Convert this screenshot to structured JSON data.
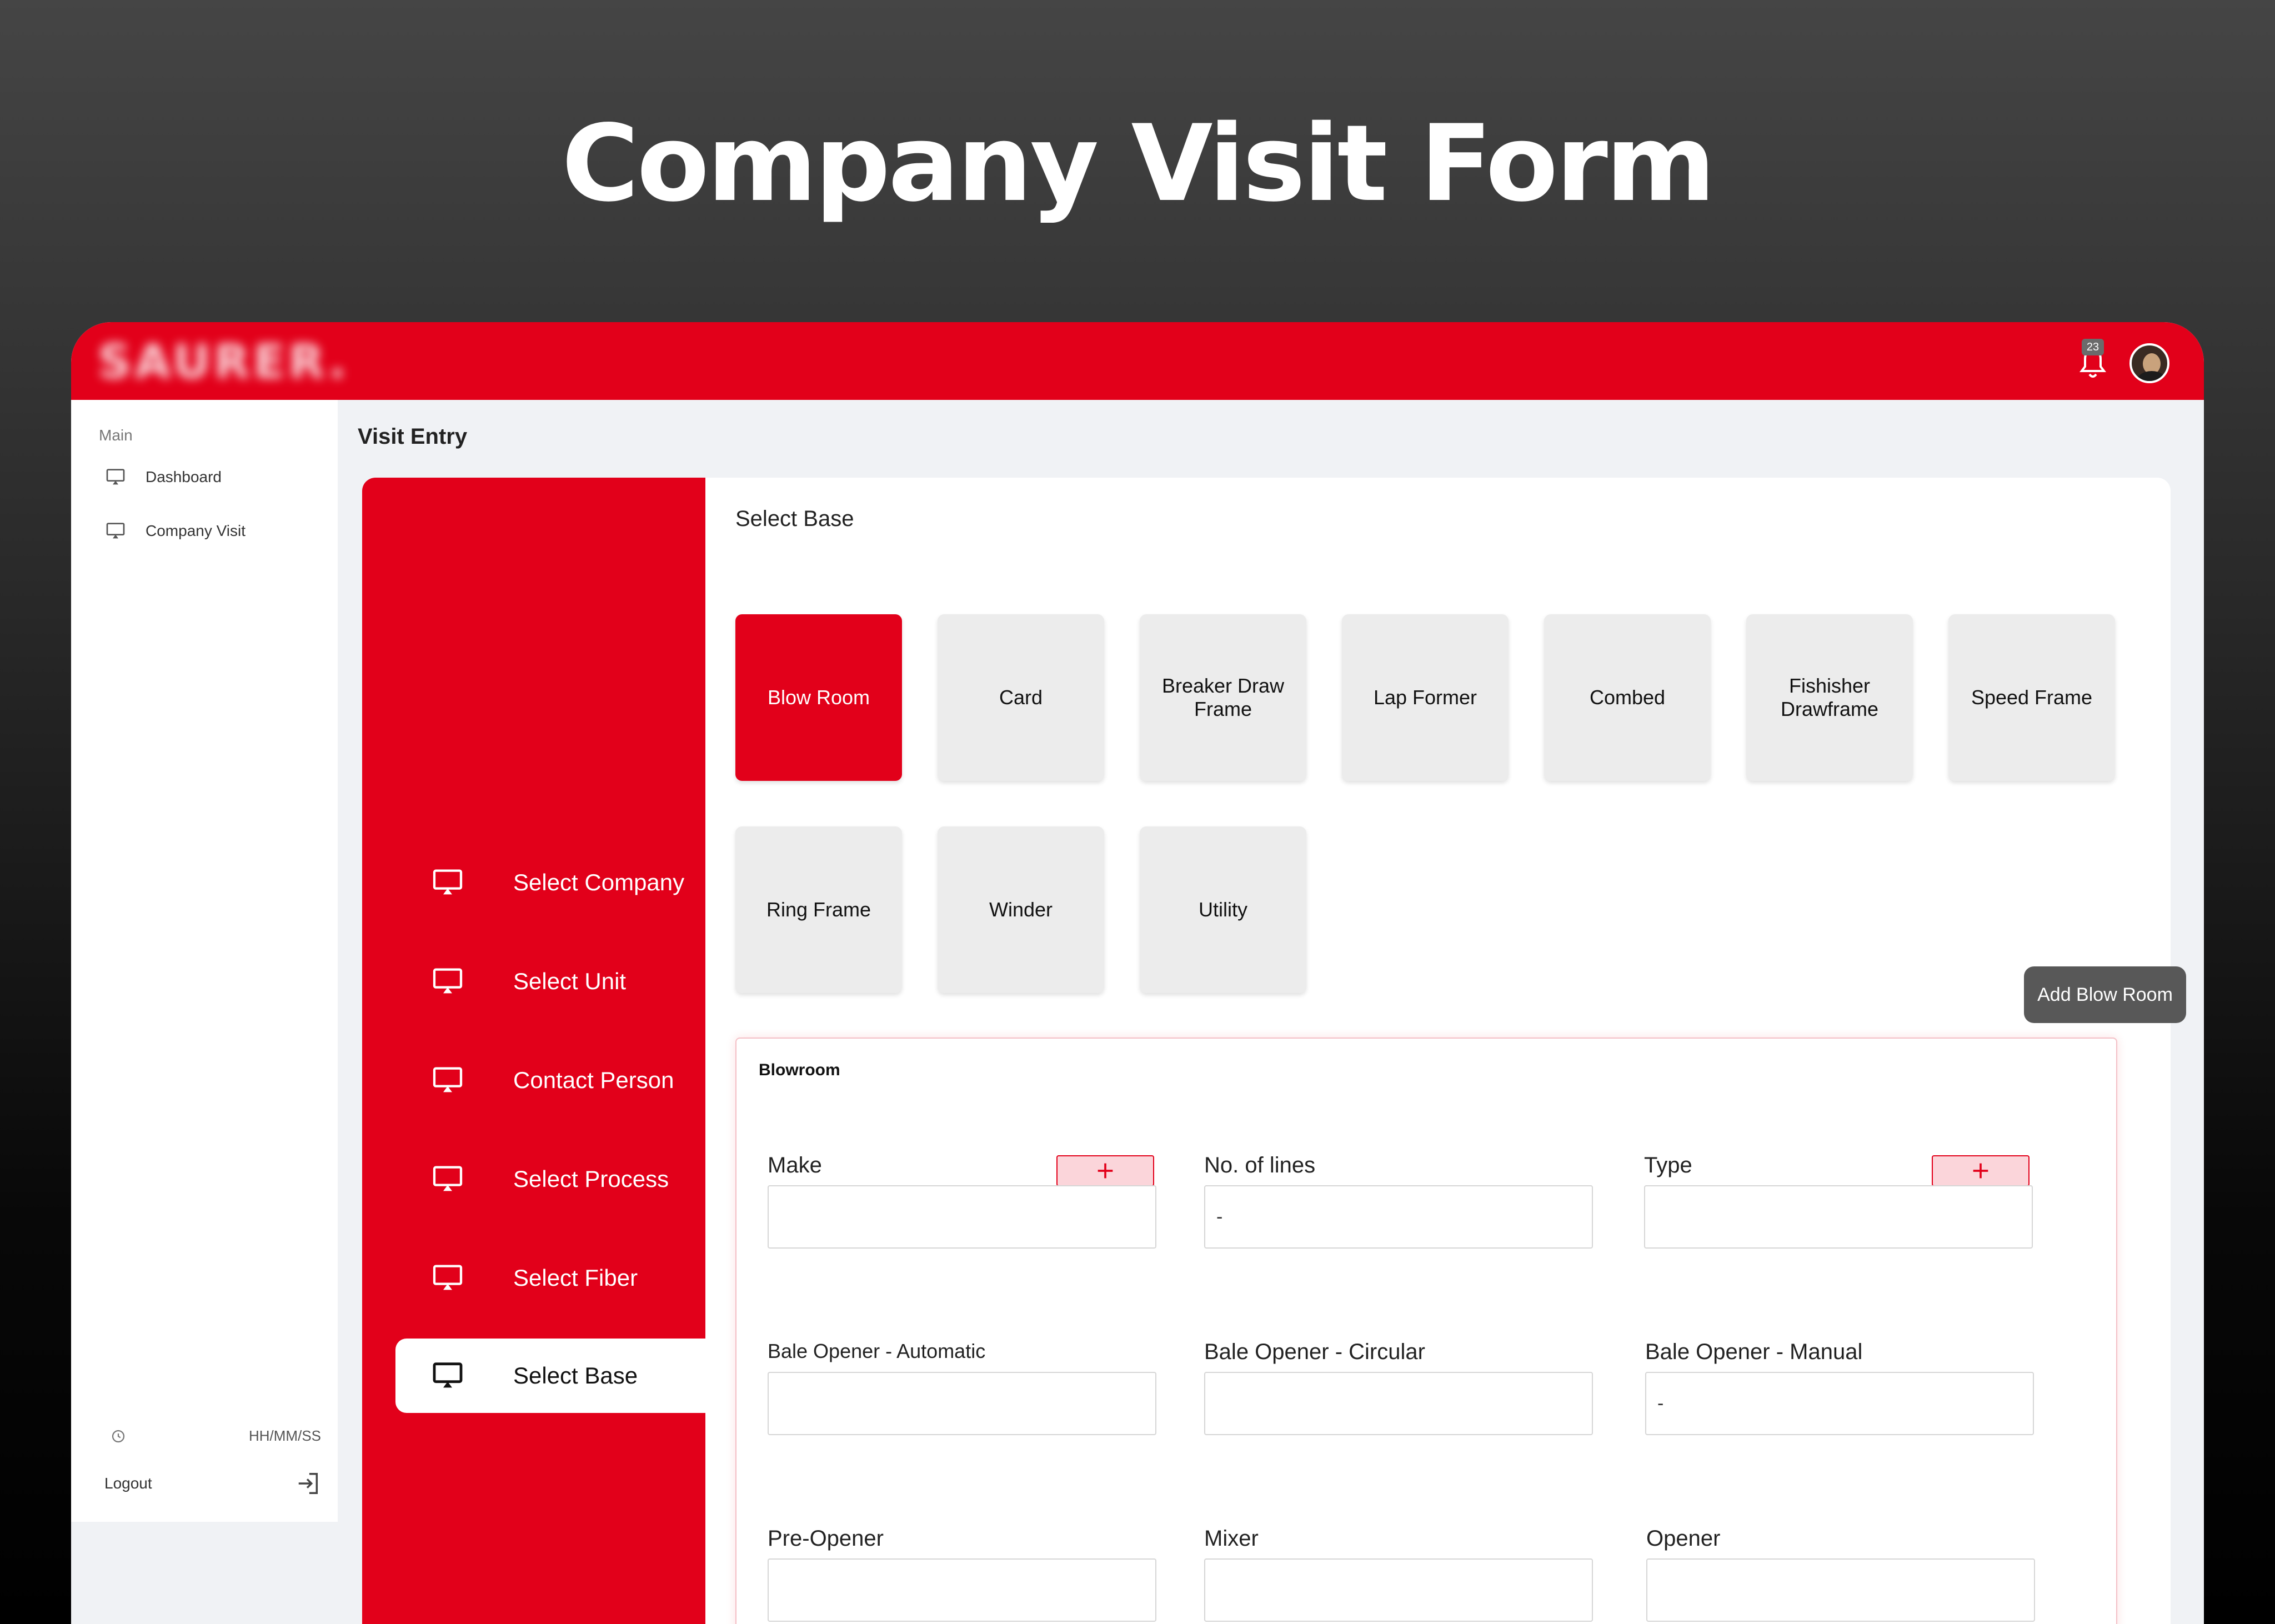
{
  "hero": {
    "title": "Company Visit Form"
  },
  "topbar": {
    "brand": "SAURER.",
    "notification_count": "23"
  },
  "sidebar": {
    "section": "Main",
    "items": [
      {
        "label": "Dashboard",
        "icon": "monitor-icon"
      },
      {
        "label": "Company Visit",
        "icon": "monitor-icon"
      }
    ],
    "time": "HH/MM/SS",
    "logout": "Logout"
  },
  "page": {
    "title": "Visit Entry"
  },
  "steps": [
    {
      "label": "Select Company"
    },
    {
      "label": "Select Unit"
    },
    {
      "label": "Contact Person"
    },
    {
      "label": "Select Process"
    },
    {
      "label": "Select Fiber"
    },
    {
      "label": "Select Base",
      "active": true
    }
  ],
  "base": {
    "title": "Select Base",
    "tiles": [
      "Blow Room",
      "Card",
      "Breaker Draw Frame",
      "Lap Former",
      "Combed",
      "Fishisher Drawframe",
      "Speed Frame",
      "Ring Frame",
      "Winder",
      "Utility"
    ],
    "selected": "Blow Room",
    "add_button": "Add Blow Room"
  },
  "form": {
    "title": "Blowroom",
    "fields": [
      {
        "label": "Make",
        "value": ""
      },
      {
        "label": "No. of lines",
        "value": "-"
      },
      {
        "label": "Type",
        "value": ""
      },
      {
        "label": "Bale Opener - Automatic",
        "value": ""
      },
      {
        "label": "Bale Opener - Circular",
        "value": ""
      },
      {
        "label": "Bale Opener - Manual",
        "value": "-"
      },
      {
        "label": "Pre-Opener",
        "value": ""
      },
      {
        "label": "Mixer",
        "value": ""
      },
      {
        "label": "Opener",
        "value": ""
      }
    ]
  },
  "colors": {
    "accent": "#e2001a",
    "tile": "#ececec",
    "button_dark": "#585858"
  }
}
